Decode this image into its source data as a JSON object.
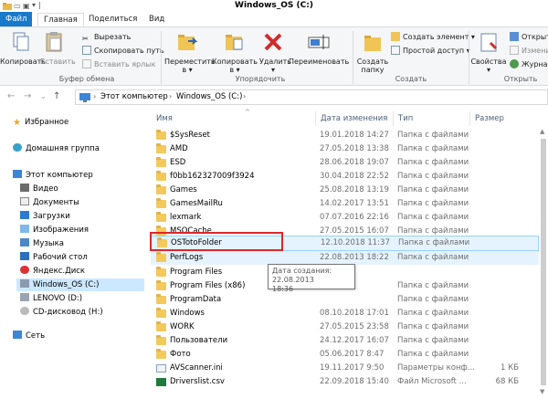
{
  "window": {
    "title": "Windows_OS (C:)"
  },
  "tabs": [
    "Файл",
    "Главная",
    "Поделиться",
    "Вид"
  ],
  "ribbon": {
    "clipboard": {
      "copy": "Копировать",
      "paste": "Вставить",
      "cut": "Вырезать",
      "copy_path": "Скопировать путь",
      "paste_shortcut": "Вставить ярлык",
      "label": "Буфер обмена"
    },
    "organize": {
      "move_to": "Переместить",
      "move_to2": "в ▾",
      "copy_to": "Копировать",
      "copy_to2": "в ▾",
      "delete": "Удалить",
      "delete2": "▾",
      "rename": "Переименовать",
      "label": "Упорядочить"
    },
    "new": {
      "new_folder": "Создать",
      "new_folder2": "папку",
      "new_item": "Создать элемент ▾",
      "easy_access": "Простой доступ ▾",
      "label": "Создать"
    },
    "open": {
      "properties": "Свойства",
      "properties2": "▾",
      "open": "Открыт",
      "edit": "Измени",
      "history": "Журнал",
      "label": "Открыть"
    }
  },
  "address": {
    "path_root": "Этот компьютер",
    "path_drive": "Windows_OS (C:)"
  },
  "nav": {
    "favorites": "Избранное",
    "homegroup": "Домашняя группа",
    "this_pc": "Этот компьютер",
    "video": "Видео",
    "documents": "Документы",
    "downloads": "Загрузки",
    "images": "Изображения",
    "music": "Музыка",
    "desktop": "Рабочий стол",
    "yadisk": "Яндекс.Диск",
    "windows_os": "Windows_OS (C:)",
    "lenovo": "LENOVO (D:)",
    "cd": "CD-дисковод (H:)",
    "network": "Сеть"
  },
  "columns": {
    "name": "Имя",
    "date": "Дата изменения",
    "type": "Тип",
    "size": "Размер"
  },
  "files": [
    {
      "name": "$SysReset",
      "date": "19.01.2018 14:27",
      "type": "Папка с файлами",
      "size": ""
    },
    {
      "name": "AMD",
      "date": "27.05.2018 13:38",
      "type": "Папка с файлами",
      "size": ""
    },
    {
      "name": "ESD",
      "date": "28.06.2018 19:07",
      "type": "Папка с файлами",
      "size": ""
    },
    {
      "name": "f0bb162327009f3924",
      "date": "30.04.2018 22:52",
      "type": "Папка с файлами",
      "size": ""
    },
    {
      "name": "Games",
      "date": "25.08.2018 13:19",
      "type": "Папка с файлами",
      "size": ""
    },
    {
      "name": "GamesMailRu",
      "date": "14.02.2017 13:51",
      "type": "Папка с файлами",
      "size": ""
    },
    {
      "name": "lexmark",
      "date": "07.07.2016 22:16",
      "type": "Папка с файлами",
      "size": ""
    },
    {
      "name": "MSOCache",
      "date": "27.05.2015 16:07",
      "type": "Папка с файлами",
      "size": ""
    },
    {
      "name": "OSTotoFolder",
      "date": "12.10.2018 11:37",
      "type": "Папка с файлами",
      "size": ""
    },
    {
      "name": "PerfLogs",
      "date": "22.08.2013 18:22",
      "type": "Папка с файлами",
      "size": ""
    },
    {
      "name": "Program Files",
      "date": "",
      "type": "",
      "size": ""
    },
    {
      "name": "Program Files (x86)",
      "date": "",
      "type": "Папка с файлами",
      "size": ""
    },
    {
      "name": "ProgramData",
      "date": "",
      "type": "Папка с файлами",
      "size": ""
    },
    {
      "name": "Windows",
      "date": "08.10.2018 17:01",
      "type": "Папка с файлами",
      "size": ""
    },
    {
      "name": "WORK",
      "date": "27.05.2015 23:58",
      "type": "Папка с файлами",
      "size": ""
    },
    {
      "name": "Пользователи",
      "date": "24.12.2017 16:07",
      "type": "Папка с файлами",
      "size": ""
    },
    {
      "name": "Фото",
      "date": "05.06.2017 8:47",
      "type": "Папка с файлами",
      "size": ""
    },
    {
      "name": "AVScanner.ini",
      "date": "19.11.2017 9:50",
      "type": "Параметры конф...",
      "size": "1 КБ"
    },
    {
      "name": "Driverslist.csv",
      "date": "22.09.2018 15:40",
      "type": "Файл Microsoft ...",
      "size": "68 КБ"
    }
  ],
  "tooltip": {
    "line1": "Дата создания: 22.08.2013",
    "line2": "18:36"
  },
  "colors": {
    "file_tab": "#1979ca",
    "selection": "#cce8ff",
    "highlight_box": "#e0262b",
    "folder": "#f3c95c"
  }
}
